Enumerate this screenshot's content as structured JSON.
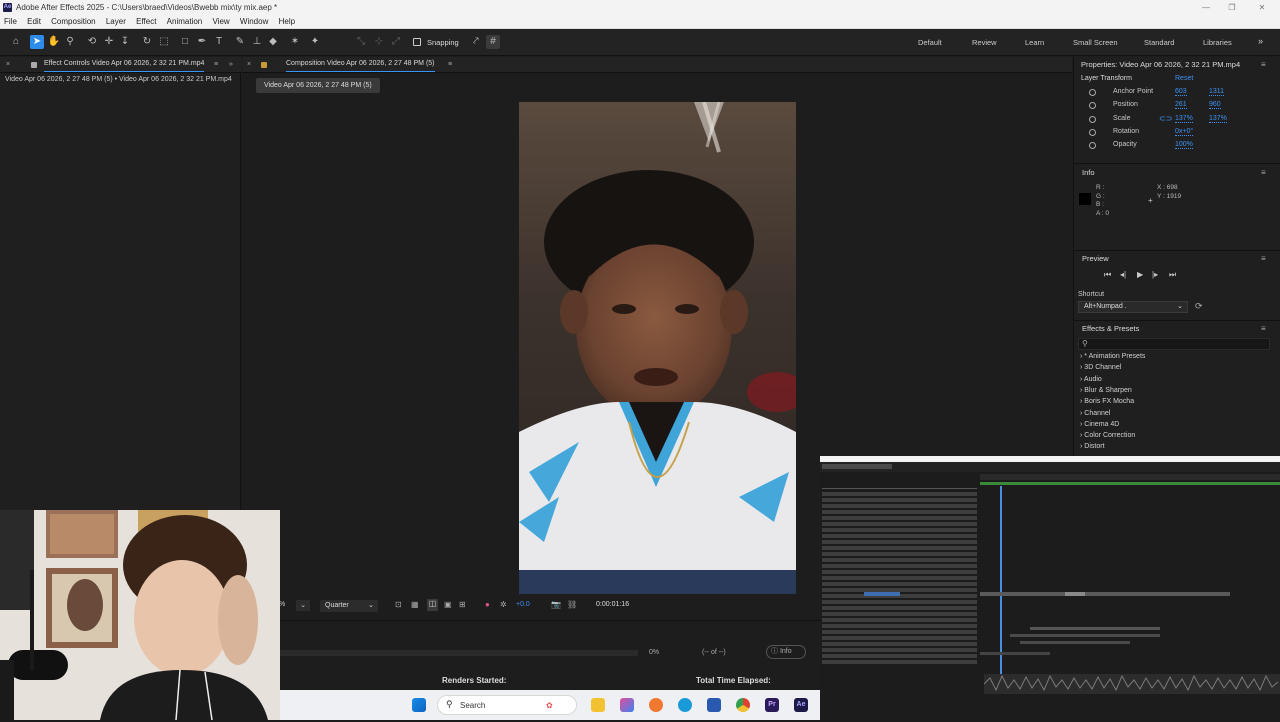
{
  "app": {
    "title": "Adobe After Effects 2025 - C:\\Users\\braed\\Videos\\Bwebb mix\\ty mix.aep *",
    "logo": "Ae",
    "window_controls": [
      "minimize-icon",
      "maximize-icon",
      "close-icon"
    ]
  },
  "menu": [
    "File",
    "Edit",
    "Composition",
    "Layer",
    "Effect",
    "Animation",
    "View",
    "Window",
    "Help"
  ],
  "toolbar": {
    "snapping_label": "Snapping",
    "workspaces": [
      "Default",
      "Review",
      "Learn",
      "Small Screen",
      "Standard",
      "Libraries"
    ],
    "more": "»"
  },
  "effect_controls": {
    "tab_label": "Effect Controls Video Apr 06 2026, 2 32 21 PM.mp4",
    "breadcrumb": "Video Apr 06 2026, 2 27 48 PM (5) • Video Apr 06 2026, 2 32 21 PM.mp4"
  },
  "composition": {
    "tab_label": "Composition Video Apr 06 2026, 2 27 48 PM (5)",
    "comp_name_tab": "Video Apr 06 2026, 2 27 48 PM (5)",
    "zoom_suffix": "%",
    "resolution": "Quarter",
    "exposure": "+0.0",
    "timecode": "0:00:01:16"
  },
  "render": {
    "progress": "0%",
    "count": "(-- of --)",
    "info_label": "Info",
    "renders_started": "Renders Started:",
    "total_time": "Total Time Elapsed:"
  },
  "properties": {
    "title": "Properties: Video Apr 06 2026, 2 32 21 PM.mp4",
    "section": "Layer Transform",
    "reset": "Reset",
    "rows": [
      {
        "name": "Anchor Point",
        "v1": "603",
        "v2": "1311"
      },
      {
        "name": "Position",
        "v1": "261",
        "v2": "960"
      },
      {
        "name": "Scale",
        "v1": "137%",
        "v2": "137%"
      },
      {
        "name": "Rotation",
        "v1": "0x+0°",
        "v2": ""
      },
      {
        "name": "Opacity",
        "v1": "100%",
        "v2": ""
      }
    ]
  },
  "info": {
    "title": "Info",
    "r": "R :",
    "g": "G :",
    "b": "B :",
    "a": "A : 0",
    "x": "X : 698",
    "y": "Y : 1919"
  },
  "preview": {
    "title": "Preview",
    "shortcut_label": "Shortcut",
    "shortcut_value": "Alt+Numpad ."
  },
  "effects_presets": {
    "title": "Effects & Presets",
    "search_placeholder": "",
    "items": [
      "* Animation Presets",
      "3D Channel",
      "Audio",
      "Blur & Sharpen",
      "Boris FX Mocha",
      "Channel",
      "Cinema 4D",
      "Color Correction",
      "Distort"
    ]
  },
  "taskbar": {
    "search_label": "Search"
  },
  "colors": {
    "accent": "#2d8ceb",
    "value_blue": "#3d92f5",
    "panel_bg": "#1f1f1f"
  }
}
